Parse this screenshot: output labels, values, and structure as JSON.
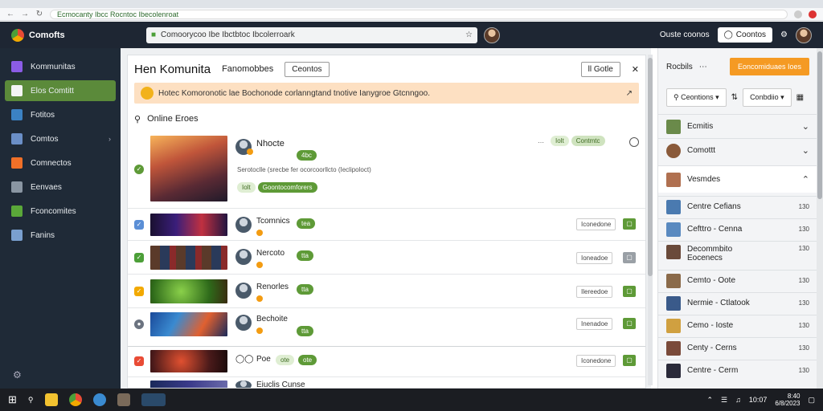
{
  "browser": {
    "url": "Ecmocanty Ibcc Rocntoc Ibecolenroat",
    "address_text": "Comoorycoo Ibe Ibctbtoc Ibcolerroark"
  },
  "header": {
    "brand": "Comofts",
    "search_text": "Comoorycoo Ibe Ibctbtoc Ibcolerroark",
    "right_text": "Ouste coonos",
    "right_button": "Coontos"
  },
  "sidebar": {
    "items": [
      {
        "label": "Kommunitas",
        "icon": "community-icon",
        "color": "#8b5ce6"
      },
      {
        "label": "Elos Comtitt",
        "icon": "home-icon",
        "color": "#f5f5f5"
      },
      {
        "label": "Fotitos",
        "icon": "feather-icon",
        "color": "#3b82c4"
      },
      {
        "label": "Comtos",
        "icon": "chat-icon",
        "color": "#6b8fc7"
      },
      {
        "label": "Comnectos",
        "icon": "connect-icon",
        "color": "#f07028"
      },
      {
        "label": "Eenvaes",
        "icon": "grid-icon",
        "color": "#8a96a3"
      },
      {
        "label": "Fconcomites",
        "icon": "puzzle-icon",
        "color": "#5aa839"
      },
      {
        "label": "Fanins",
        "icon": "user-icon",
        "color": "#7aa0d0"
      }
    ],
    "settings_icon": "gear-icon"
  },
  "main": {
    "title": "Hen Komunita",
    "tab_label": "Fanomobbes",
    "tab_button": "Ceontos",
    "head_button": "ll Gotle",
    "alert": "Hotec Komoronotic lae Bochonode corlanngtand tnotive Ianygroe Gtcnngoo.",
    "online_title": "Online Eroes",
    "feature": {
      "name": "Nhocte",
      "badge": "4bc",
      "desc": "Serotoclle (srecbe fer ocorcoorllcto (Ieclipoloct)",
      "pill_light": "Iolt",
      "pill_dark": "Goontocomforers",
      "tag_light": "Iolt",
      "tag_dark": "Contmtc"
    },
    "rows": [
      {
        "name": "Tcomnics",
        "badge": "tea",
        "action": "Iconedone",
        "check_color": "#5b8fd6",
        "sq_color": "#5e9a37"
      },
      {
        "name": "Nercoto",
        "badge": "tta",
        "action": "Ioneadoe",
        "check_color": "#4c9f38",
        "sq_color": "#9aa0a6"
      },
      {
        "name": "Renorles",
        "badge": "tta",
        "action": "Ilereedoe",
        "check_color": "#f2a900",
        "sq_color": "#5e9a37"
      },
      {
        "name": "Bechoite",
        "badge": "tta",
        "action": "Inenadoe",
        "check_color": "#6b7380",
        "sq_color": "#5e9a37"
      },
      {
        "name": "Poe",
        "badge": "ote",
        "action": "Iconedone",
        "check_color": "#e94b35",
        "sq_color": "#5e9a37"
      },
      {
        "name": "Eiuclis Cunse",
        "badge": "",
        "action": "",
        "check_color": "#999",
        "sq_color": "#5e9a37"
      }
    ]
  },
  "right": {
    "top_label": "Rocbils",
    "top_button": "Eoncomiduaes Ioes",
    "filter1": "Ceontions",
    "filter2": "Conbdiio",
    "sections": [
      {
        "label": "Ecmitis"
      },
      {
        "label": "Comottt"
      },
      {
        "label": "Vesmdes"
      }
    ],
    "items": [
      {
        "label": "Centre Cefians",
        "value": "130"
      },
      {
        "label": "Cefttro - Cenna",
        "value": "130"
      },
      {
        "label": "Decommbito",
        "sub": "Eocenecs",
        "value": "130"
      },
      {
        "label": "Cemto - Oote",
        "value": "130"
      },
      {
        "label": "Nermie - Ctlatook",
        "value": "130"
      },
      {
        "label": "Cemo - Ioste",
        "value": "130"
      },
      {
        "label": "Centy - Cerns",
        "value": "130"
      },
      {
        "label": "Centre - Cerm",
        "value": "130"
      }
    ]
  },
  "taskbar": {
    "time": "8:40",
    "date": "6/8/2023",
    "clock_text": "10:07"
  }
}
